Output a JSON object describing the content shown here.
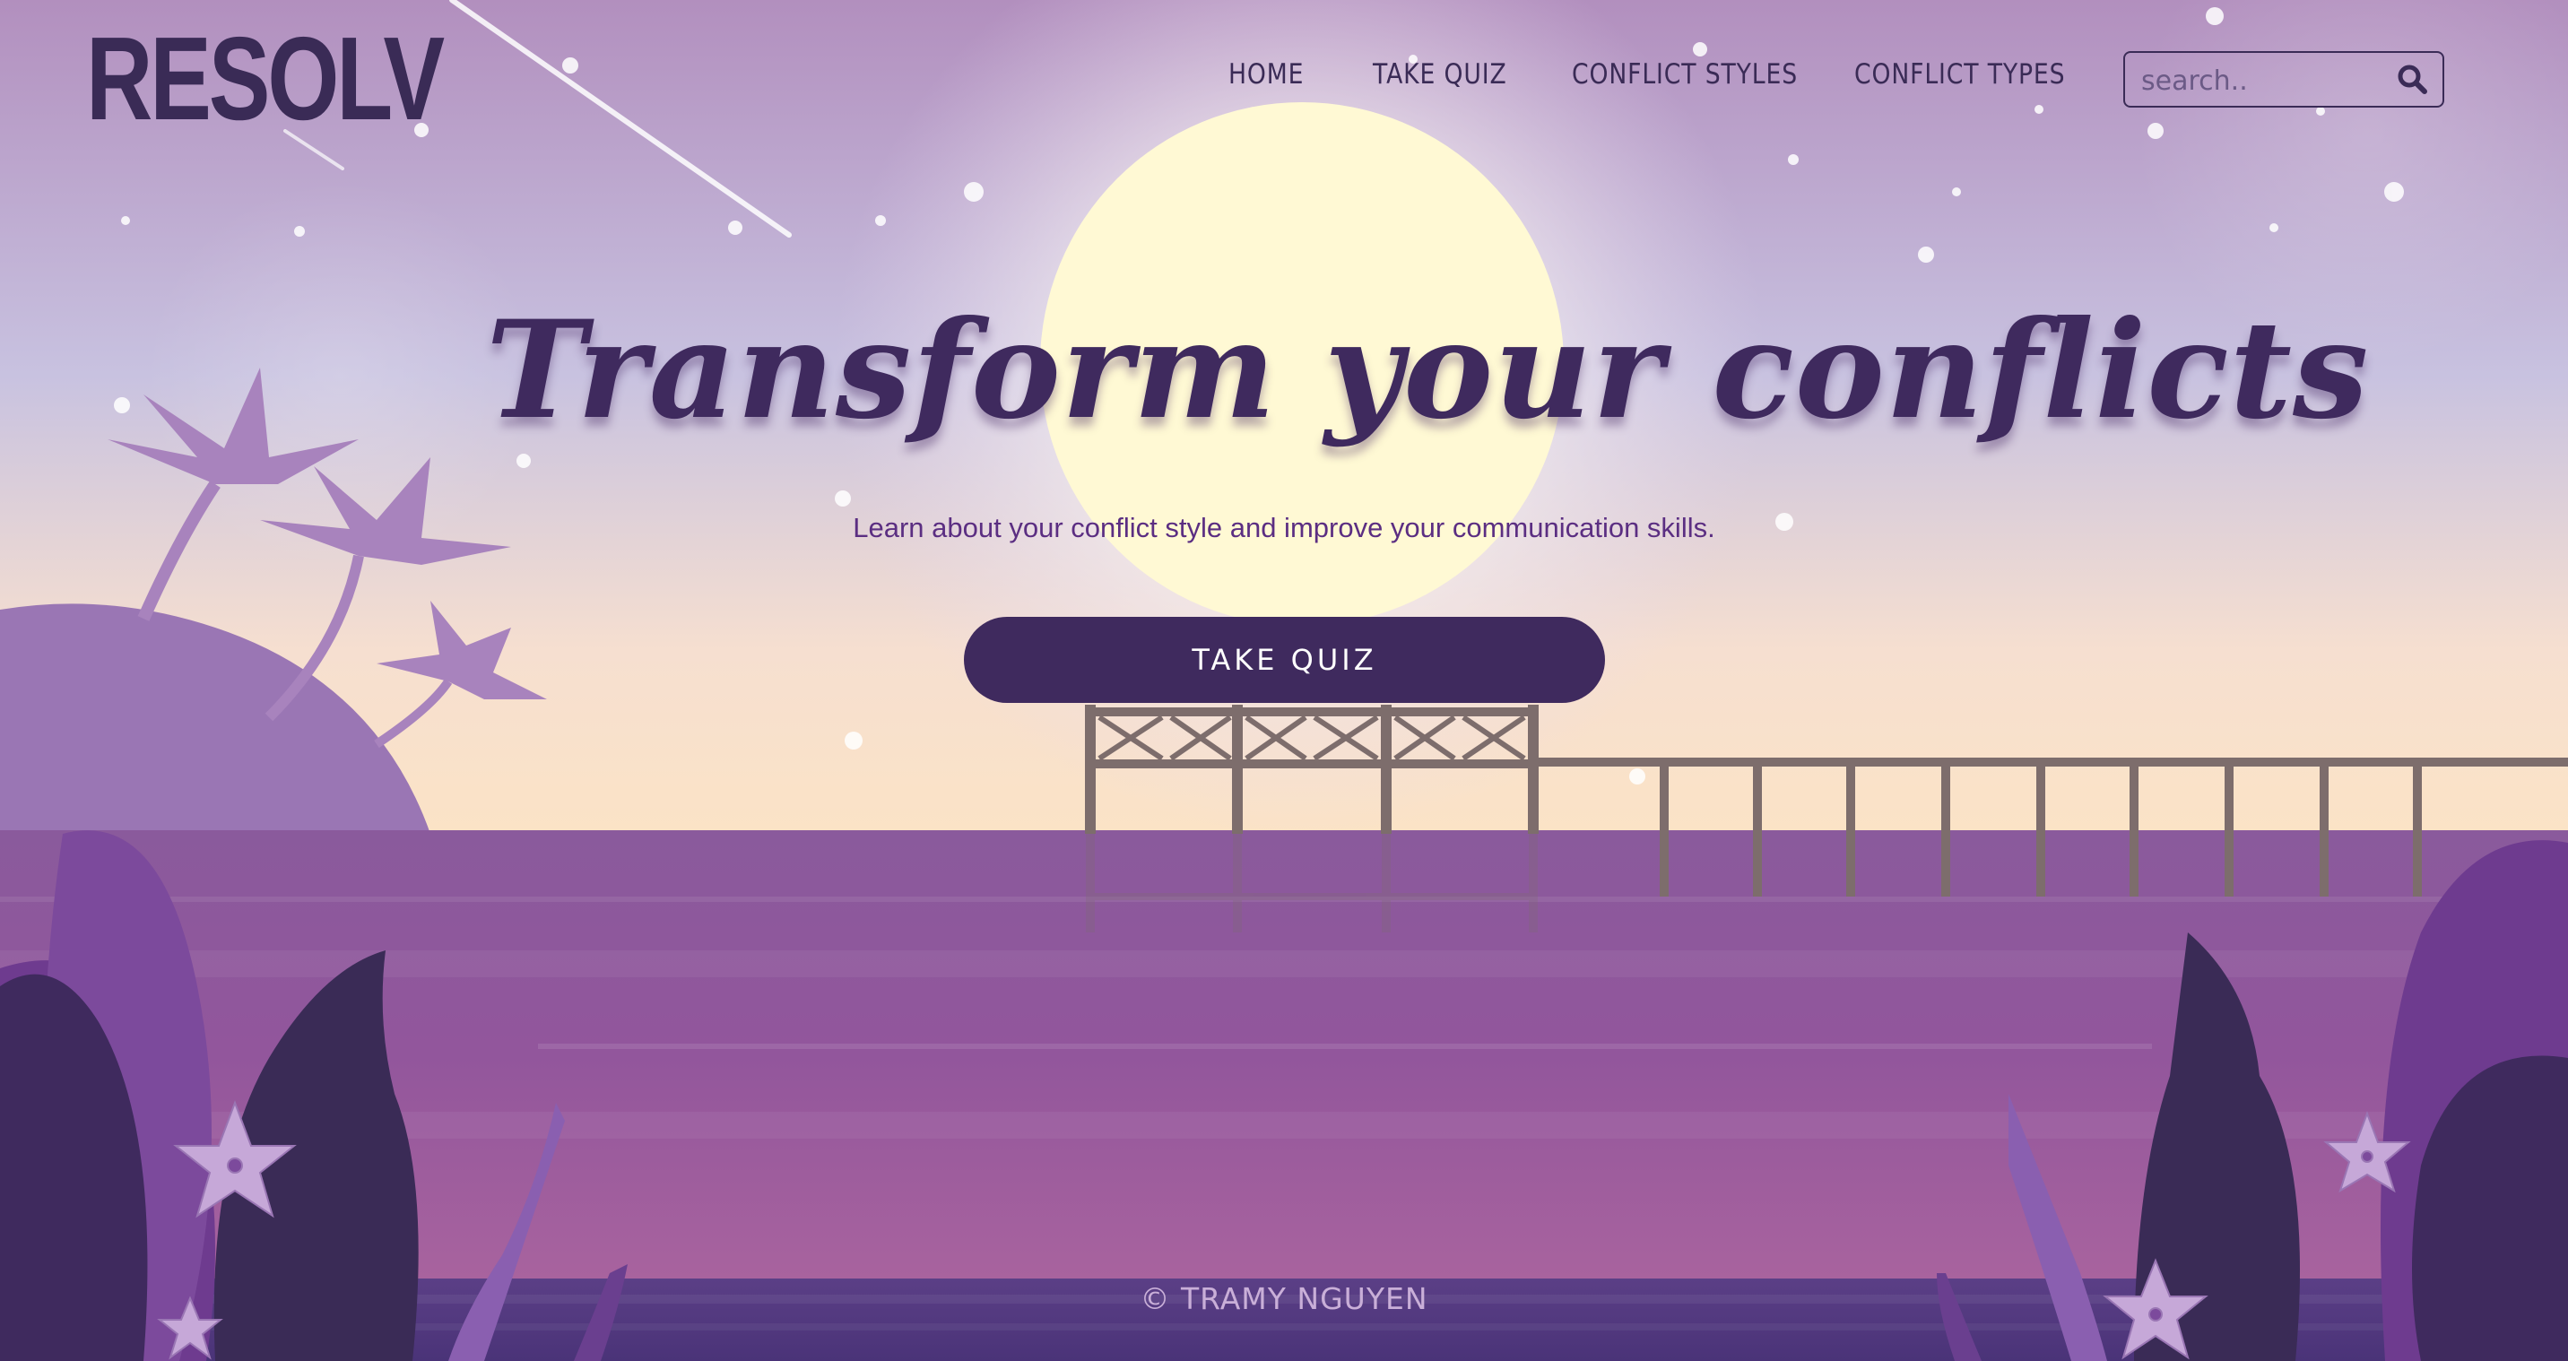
{
  "brand": {
    "logo_text": "RESOLV"
  },
  "nav": {
    "items": [
      {
        "label": "HOME"
      },
      {
        "label": "TAKE QUIZ"
      },
      {
        "label": "CONFLICT STYLES"
      },
      {
        "label": "CONFLICT TYPES"
      }
    ]
  },
  "search": {
    "placeholder": "search..",
    "value": "",
    "icon": "search-icon"
  },
  "hero": {
    "title": "Transform your conflicts",
    "subtitle": "Learn about your conflict style and improve your communication skills.",
    "cta_label": "TAKE QUIZ"
  },
  "footer": {
    "copyright": "© TRAMY NGUYEN"
  },
  "colors": {
    "brand_dark": "#3a2b56",
    "headline": "#3f2a5e",
    "subtitle": "#5b2e82",
    "button_bg": "#3f2a5e",
    "button_text": "#ffffff",
    "moon": "#fff9d6",
    "water": "#8a569c",
    "footer_text": "#c9afd8"
  }
}
